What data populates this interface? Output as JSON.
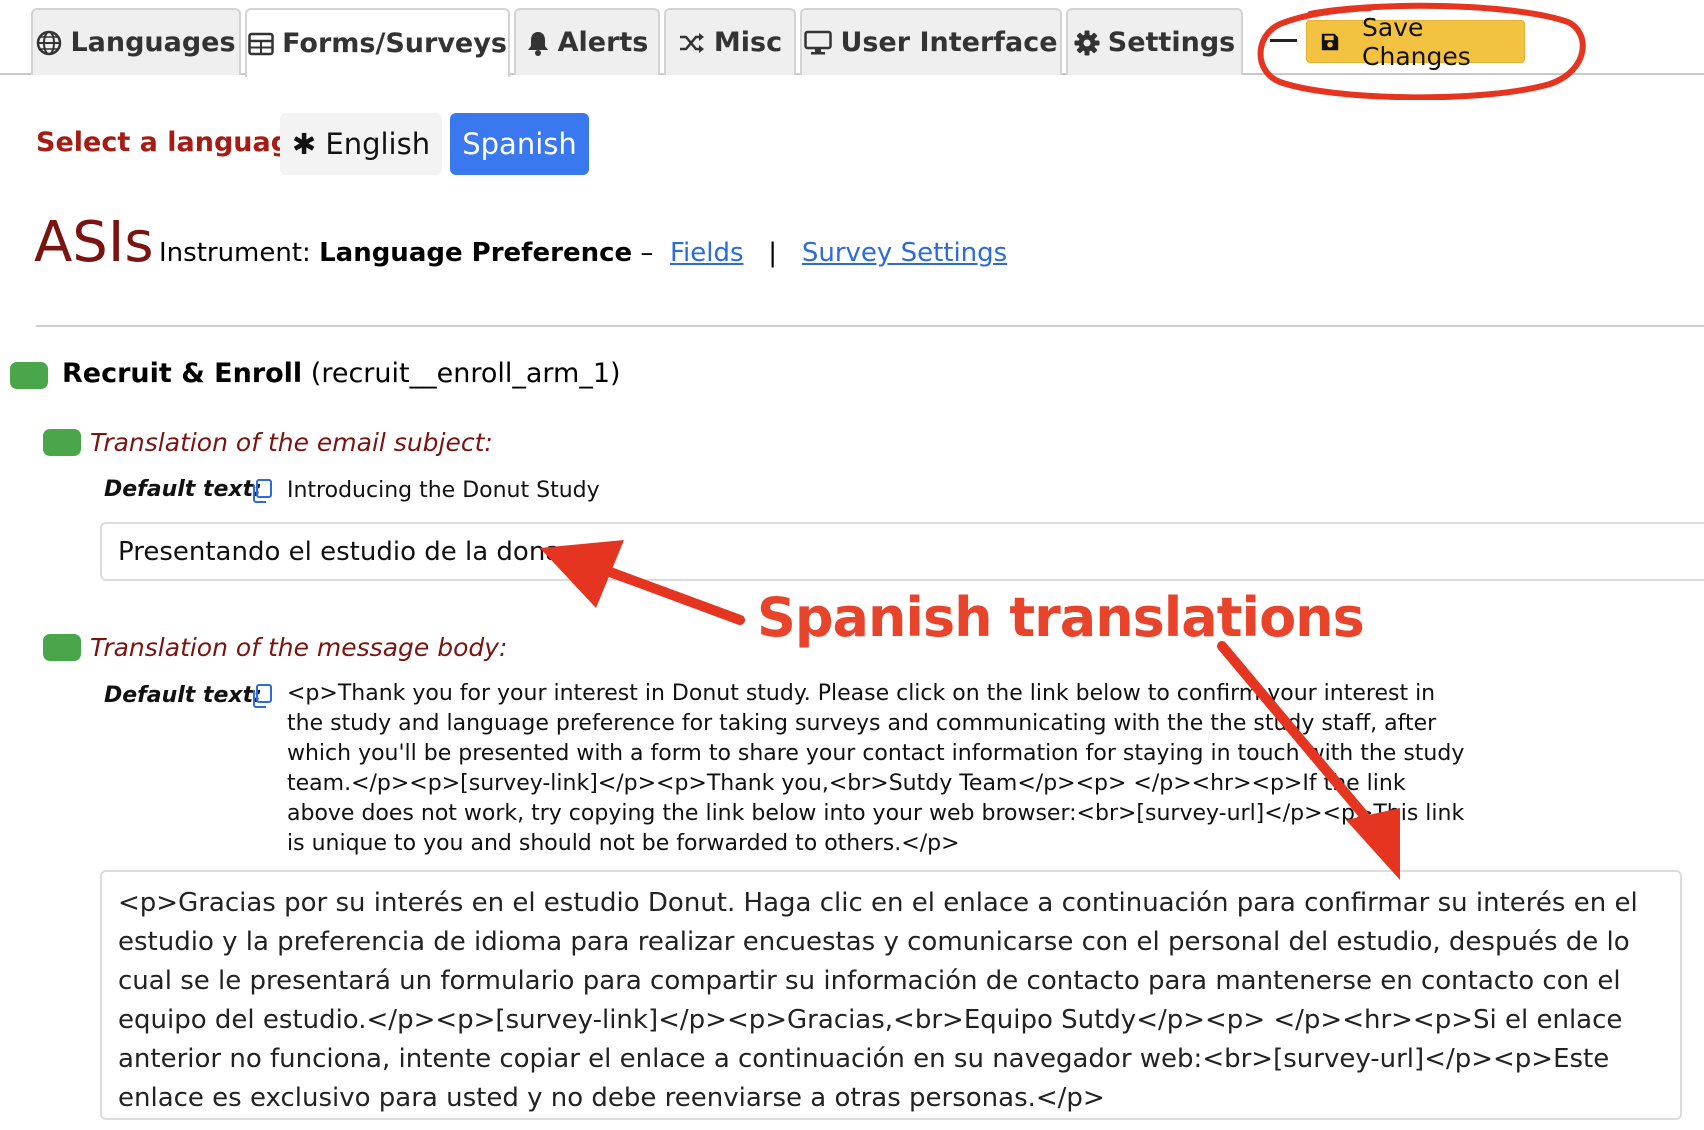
{
  "tabs": [
    {
      "label": "Languages",
      "icon": "globe-icon"
    },
    {
      "label": "Forms/Surveys",
      "icon": "table-icon",
      "active": true
    },
    {
      "label": "Alerts",
      "icon": "bell-icon"
    },
    {
      "label": "Misc",
      "icon": "shuffle-icon"
    },
    {
      "label": "User Interface",
      "icon": "monitor-icon"
    },
    {
      "label": "Settings",
      "icon": "gear-icon"
    }
  ],
  "toolbar": {
    "save_label": "Save Changes",
    "save_icon": "floppy-disk-icon"
  },
  "language_select": {
    "label": "Select a language:",
    "options": [
      {
        "label": "✱ English"
      },
      {
        "label": "Spanish",
        "selected": true
      }
    ]
  },
  "header": {
    "project": "ASIs",
    "instrument_label": "Instrument:",
    "instrument_name": "Language Preference",
    "separator_dash": "–",
    "fields_link": "Fields",
    "link_divider": "|",
    "survey_settings_link": "Survey Settings"
  },
  "event": {
    "name": "Recruit & Enroll",
    "id": "(recruit__enroll_arm_1)"
  },
  "email_subject": {
    "title": "Translation of the email subject:",
    "default_label": "Default text:",
    "default_text": "Introducing the Donut Study",
    "value": "Presentando el estudio de la dona"
  },
  "message_body": {
    "title": "Translation of the message body:",
    "default_label": "Default text:",
    "default_text": "<p>Thank you for your interest in Donut study. Please click on the link below to confirm your interest in the study and language preference for taking surveys and communicating with the the study staff, after which you'll be presented with a form to share your contact information for staying in touch with the study team.</p><p>[survey-link]</p><p>Thank you,<br>Sutdy Team</p><p> </p><hr><p>If the link above does not work, try copying the link below into your web browser:<br>[survey-url]</p><p>This link is unique to you and should not be forwarded to others.</p>",
    "value": "<p>Gracias por su interés en el estudio Donut. Haga clic en el enlace a continuación para confirmar su interés en el estudio y la preferencia de idioma para realizar encuestas y comunicarse con el personal del estudio, después de lo cual se le presentará un formulario para compartir su información de contacto para mantenerse en contacto con el equipo del estudio.</p><p>[survey-link]</p><p>Gracias,<br>Equipo Sutdy</p><p> </p><hr><p>Si el enlace anterior no funciona, intente copiar el enlace a continuación en su navegador web:<br>[survey-url]</p><p>Este enlace es exclusivo para usted y no debe reenviarse a otras personas.</p>"
  },
  "annotation": {
    "text": "Spanish translations",
    "color": "#e8432b"
  },
  "colors": {
    "save_button": "#f4c241",
    "selected_language": "#3a78f0",
    "status_pill": "#4aa64a",
    "dark_red": "#7a1410",
    "link": "#2c6bd8"
  }
}
